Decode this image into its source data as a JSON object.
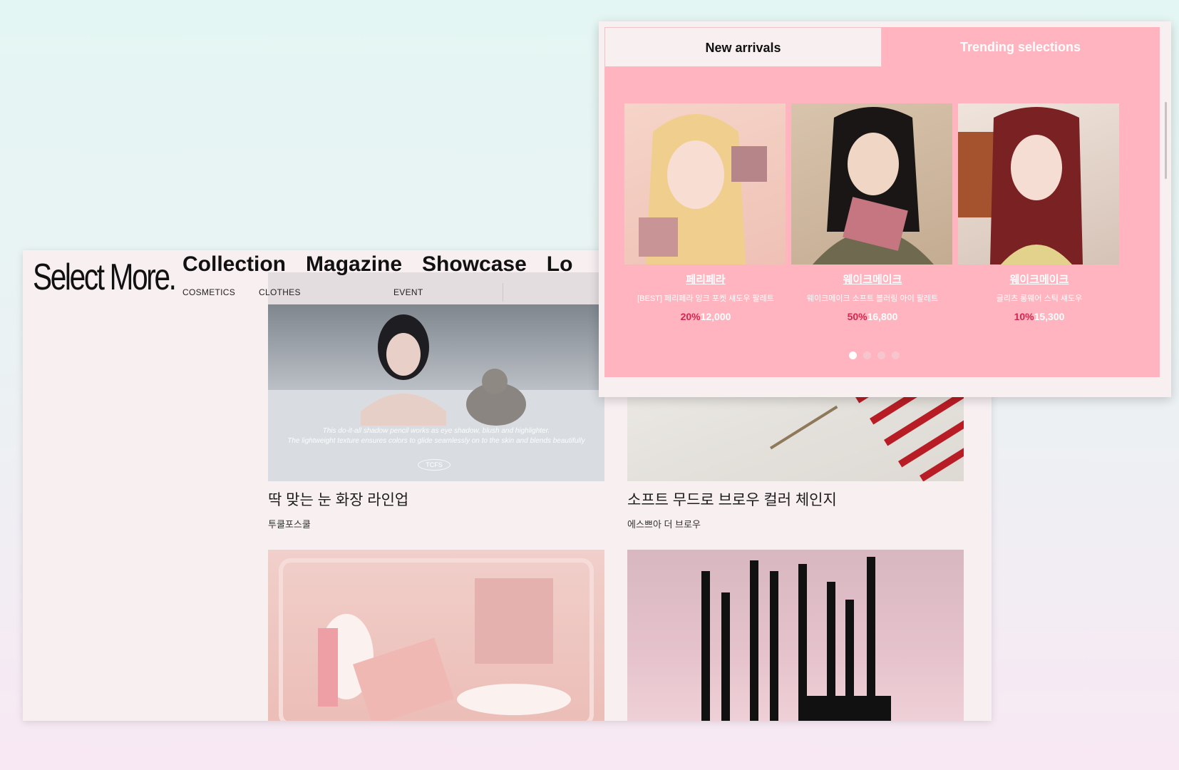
{
  "site": {
    "logo": "Select More.",
    "nav": [
      "Collection",
      "Magazine",
      "Showcase",
      "Lo"
    ],
    "subnav": [
      "COSMETICS",
      "CLOTHES",
      "EVENT"
    ]
  },
  "cards": [
    {
      "title": "딱 맞는 눈 화장 라인업",
      "brand": "투쿨포스쿨",
      "caption_1": "This do-it-all shadow pencil works as eye shadow, blush and highlighter.",
      "caption_2": "The lightweight texture ensures colors to glide seamlessly on to the skin and blends beautifully",
      "logo": "TCFS"
    },
    {
      "title": "소프트 무드로 브로우 컬러 체인지",
      "brand": "에스쁘아 더 브로우"
    },
    {
      "title": "",
      "brand": ""
    },
    {
      "title": "",
      "brand": ""
    }
  ],
  "panel": {
    "tabs": [
      "New arrivals",
      "Trending selections"
    ],
    "products": [
      {
        "brand": "페리페라",
        "name": "[BEST] 페리페라 잉크 포켓 섀도우 팔레트",
        "discount": "20%",
        "price": "12,000"
      },
      {
        "brand": "웨이크메이크",
        "name": "웨이크메이크 소프트 블러링 아이 팔레트",
        "discount": "50%",
        "price": "16,800"
      },
      {
        "brand": "웨이크메이크",
        "name": "글리츠 롱웨어 스틱 섀도우",
        "discount": "10%",
        "price": "15,300"
      }
    ],
    "carousel": {
      "pages": 4,
      "current": 1
    }
  },
  "colors": {
    "panel_pink": "#ffb4c0",
    "discount_red": "#d5264d",
    "page_bg": "#f7eff0"
  }
}
